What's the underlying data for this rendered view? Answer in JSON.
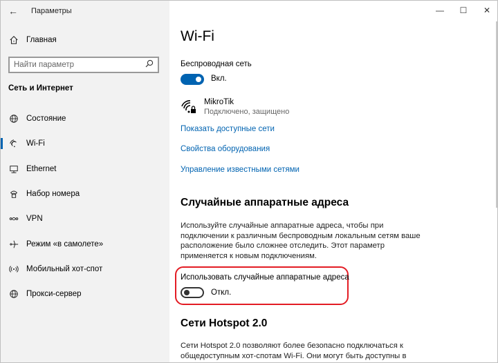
{
  "window": {
    "title": "Параметры",
    "controls": {
      "minimize": "—",
      "maximize": "☐",
      "close": "✕"
    }
  },
  "sidebar": {
    "home_label": "Главная",
    "search": {
      "placeholder": "Найти параметр",
      "value": ""
    },
    "section_label": "Сеть и Интернет",
    "active_index": 1,
    "items": [
      {
        "label": "Состояние",
        "icon": "globe-status-icon"
      },
      {
        "label": "Wi-Fi",
        "icon": "wifi-icon"
      },
      {
        "label": "Ethernet",
        "icon": "ethernet-icon"
      },
      {
        "label": "Набор номера",
        "icon": "dialup-icon"
      },
      {
        "label": "VPN",
        "icon": "vpn-icon"
      },
      {
        "label": "Режим «в самолете»",
        "icon": "airplane-icon"
      },
      {
        "label": "Мобильный хот-спот",
        "icon": "hotspot-icon"
      },
      {
        "label": "Прокси-сервер",
        "icon": "globe-icon"
      }
    ]
  },
  "main": {
    "title": "Wi-Fi",
    "wireless": {
      "label": "Беспроводная сеть",
      "toggle_on": true,
      "toggle_text": "Вкл."
    },
    "network": {
      "name": "MikroTik",
      "status": "Подключено, защищено"
    },
    "links": [
      "Показать доступные сети",
      "Свойства оборудования",
      "Управление известными сетями"
    ],
    "random_hw": {
      "heading": "Случайные аппаратные адреса",
      "description": "Используйте случайные аппаратные адреса, чтобы при подключении к различным беспроводным локальным сетям ваше расположение было сложнее отследить. Этот параметр применяется к новым подключениям.",
      "toggle_label": "Использовать случайные аппаратные адреса",
      "toggle_on": false,
      "toggle_text": "Откл."
    },
    "hotspot": {
      "heading": "Сети Hotspot 2.0",
      "description": "Сети Hotspot 2.0 позволяют более безопасно подключаться к общедоступным хот-спотам Wi-Fi. Они могут быть доступны в"
    }
  },
  "colors": {
    "accent": "#0063b1",
    "highlight": "#e31b23",
    "sidebar_bg": "#f2f2f2"
  }
}
